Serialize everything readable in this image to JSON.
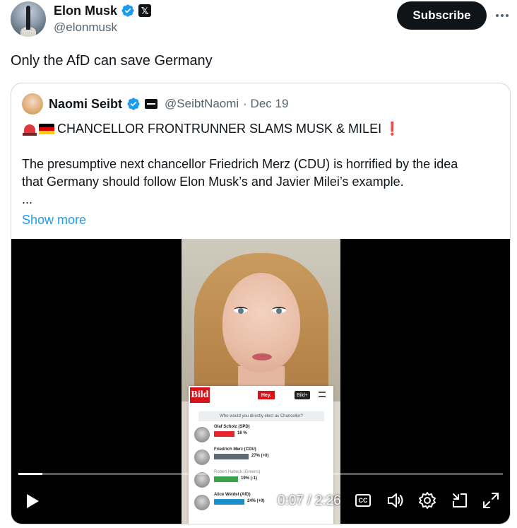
{
  "post": {
    "author_name": "Elon Musk",
    "author_handle": "@elonmusk",
    "subscribe_label": "Subscribe",
    "text": "Only the AfD can save Germany"
  },
  "quote": {
    "author_name": "Naomi Seibt",
    "author_handle": "@SeibtNaomi",
    "date": "· Dec 19",
    "headline": "CHANCELLOR FRONTRUNNER SLAMS MUSK & MILEI",
    "exclaim": "❗",
    "paragraph_line1": "The presumptive next chancellor Friedrich Merz (CDU) is horrified by the idea",
    "paragraph_line2": "that Germany should follow Elon Musk’s and Javier Milei’s example.",
    "ellipsis": "...",
    "show_more": "Show more"
  },
  "video": {
    "time": "0:07 / 2:26",
    "progress": 0.05,
    "cc_label": "CC",
    "bild": {
      "logo": "Bild",
      "hey": "Hey.",
      "plus": "Bild+",
      "question": "Who would you directly elect as Chancellor?",
      "candidates": [
        {
          "name": "Olaf Scholz (SPD)",
          "pct": "16 %",
          "color": "#e8262c",
          "share": 0.16
        },
        {
          "name": "Friedrich Merz (CDU)",
          "pct": "27% (+0)",
          "color": "#5d6b76",
          "share": 0.27
        },
        {
          "name": "Robert Habeck (Greens)",
          "pct": "19% (-1)",
          "color": "#3aa44b",
          "share": 0.19
        },
        {
          "name": "Alice Weidel (AfD)",
          "pct": "24% (+0)",
          "color": "#1d8fc9",
          "share": 0.24
        }
      ]
    }
  },
  "colors": {
    "brand_blue": "#1d9bf0",
    "text_primary": "#0f1419",
    "text_secondary": "#536471",
    "border": "#cfd9de"
  },
  "icons": [
    "verified-badge-icon",
    "x-affiliate-icon",
    "more-icon",
    "siren-emoji",
    "germany-flag-emoji",
    "play-icon",
    "captions-icon",
    "volume-icon",
    "settings-icon",
    "minimize-icon",
    "fullscreen-icon"
  ]
}
